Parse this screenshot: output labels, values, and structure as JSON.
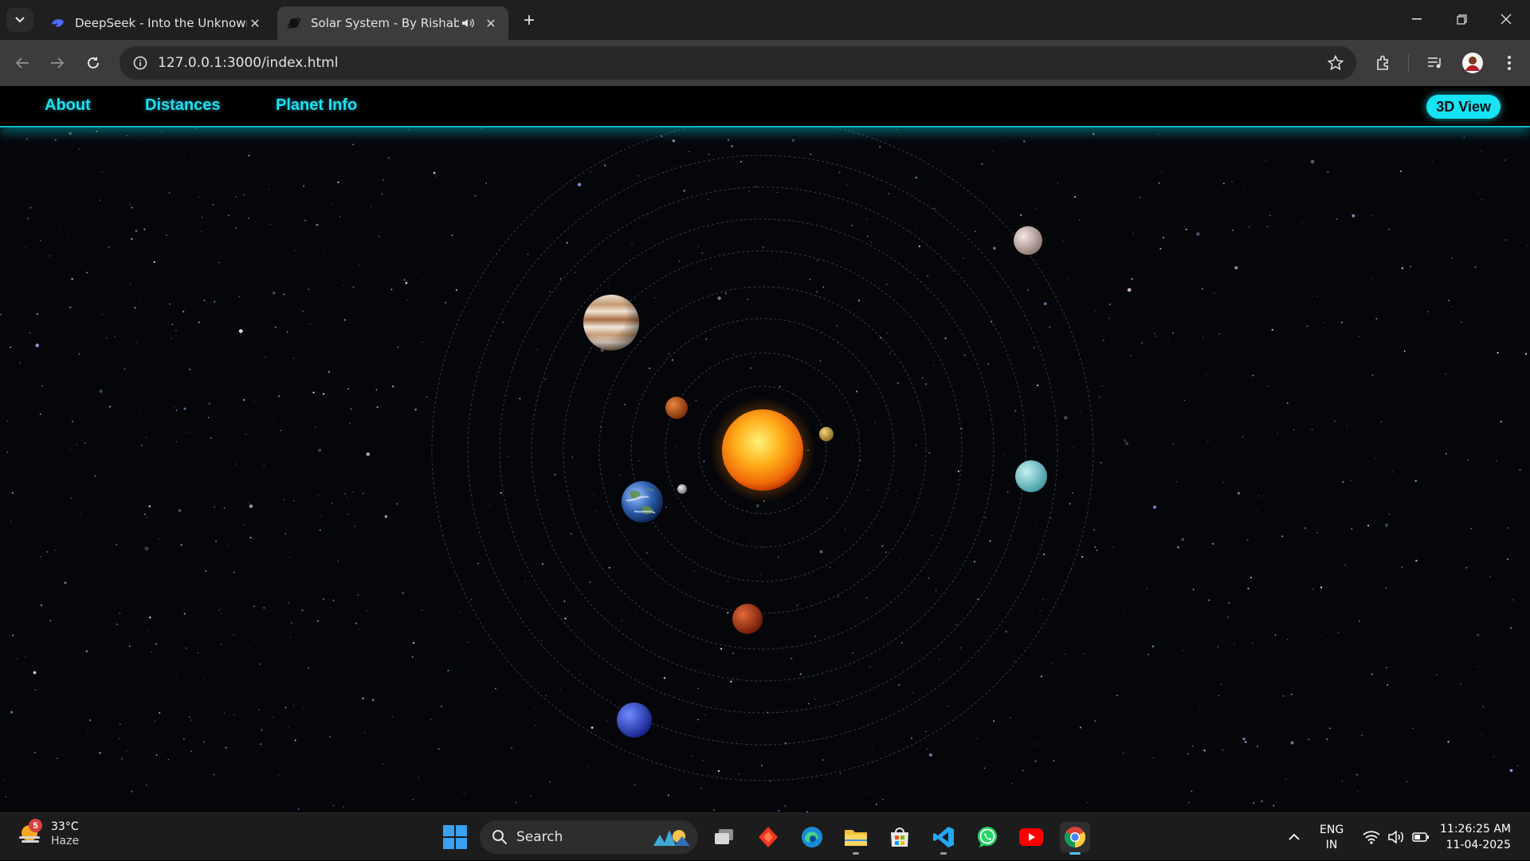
{
  "browser": {
    "tabs": [
      {
        "title": "DeepSeek - Into the Unknown",
        "icon": "deepseek-whale-icon",
        "active": false
      },
      {
        "title": "Solar System - By Rishabh",
        "icon": "planet-favicon-icon",
        "active": true,
        "audio": true
      }
    ],
    "url": "127.0.0.1:3000/index.html"
  },
  "site": {
    "nav": [
      {
        "label": "About"
      },
      {
        "label": "Distances"
      },
      {
        "label": "Planet Info"
      }
    ],
    "view_button": "3D View",
    "accent_color": "#17e3f2"
  },
  "solar_system": {
    "sun": {
      "name": "Sun",
      "color": "#ff9a10"
    },
    "orbit_count": 9,
    "planets": [
      {
        "name": "Mercury",
        "color": "#c9a64a"
      },
      {
        "name": "Venus",
        "color": "#c2571f"
      },
      {
        "name": "Moon",
        "color": "#b9b9b9"
      },
      {
        "name": "Earth",
        "color": "#3a6fbf"
      },
      {
        "name": "Mars",
        "color": "#b23a16"
      },
      {
        "name": "Jupiter",
        "color": "#d9b99a"
      },
      {
        "name": "Saturn",
        "color": "#d8c6bf"
      },
      {
        "name": "Uranus",
        "color": "#7fd6d8"
      },
      {
        "name": "Neptune",
        "color": "#2f4fe0"
      }
    ]
  },
  "taskbar": {
    "weather": {
      "temp": "33°C",
      "condition": "Haze",
      "badge": "5"
    },
    "search_label": "Search",
    "apps": [
      "task-view-icon",
      "brave-app-icon",
      "edge-icon",
      "file-explorer-icon",
      "microsoft-store-icon",
      "vscode-icon",
      "whatsapp-icon",
      "youtube-icon",
      "chrome-icon"
    ],
    "lang": {
      "line1": "ENG",
      "line2": "IN"
    },
    "time": "11:26:25 AM",
    "date": "11-04-2025"
  }
}
